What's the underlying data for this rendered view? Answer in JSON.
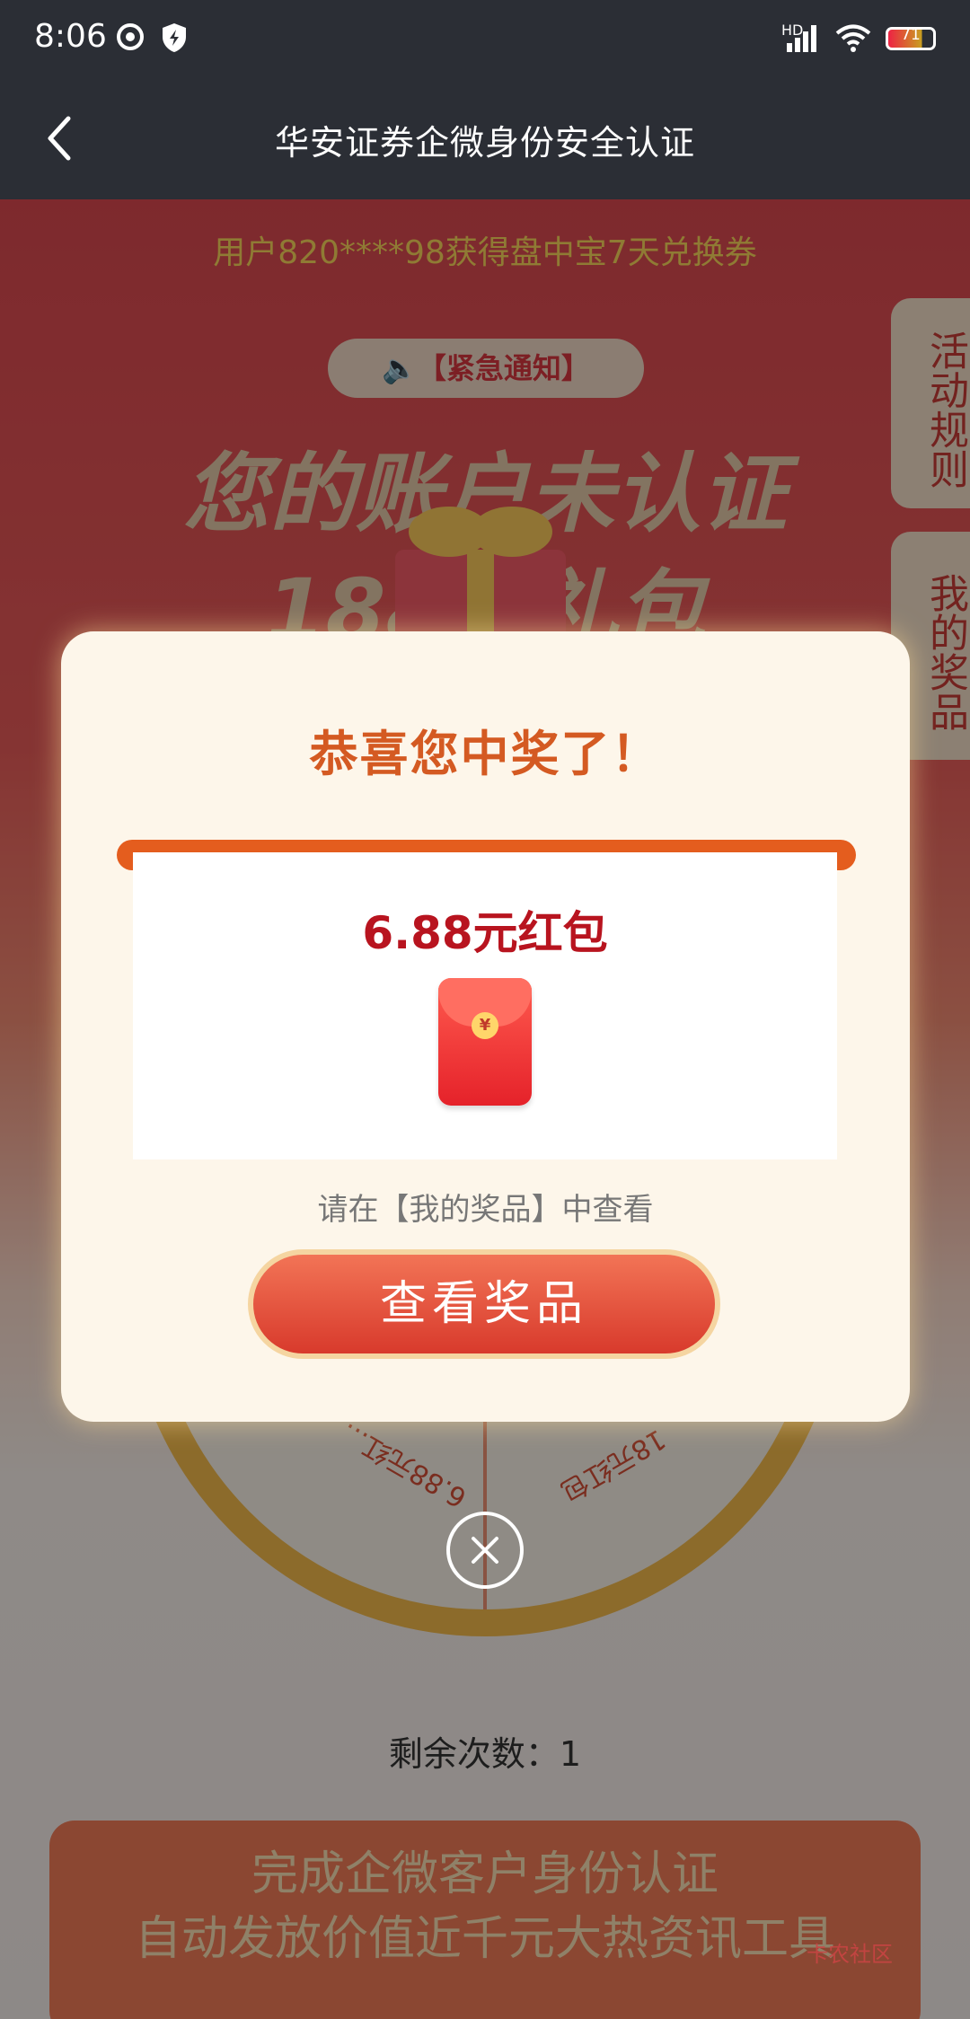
{
  "status_bar": {
    "time": "8:06",
    "battery": "71",
    "network": "HD"
  },
  "nav": {
    "title": "华安证券企微身份安全认证"
  },
  "background": {
    "ticker": "用户820****98获得盘中宝7天兑换券",
    "notice": "【紧急通知】",
    "headline_line1": "您的账户未认证",
    "headline_line2": "188元礼包",
    "side_tab_rules": "活动规则",
    "side_tab_prizes": "我的奖品",
    "wheel_slices": [
      "6.88元红...",
      "18元红包"
    ],
    "remaining": "剩余次数：1",
    "bottom_line1": "完成企微客户身份认证",
    "bottom_line2": "自动发放价值近千元大热资讯工具"
  },
  "modal": {
    "heading": "恭喜您中奖了！",
    "prize_name": "6.88元红包",
    "envelope_symbol": "¥",
    "hint": "请在【我的奖品】中查看",
    "button": "查看奖品"
  },
  "watermark": "卡农社区",
  "colors": {
    "accent": "#d45a22",
    "prize": "#b8141f",
    "button": "#e0432f"
  }
}
